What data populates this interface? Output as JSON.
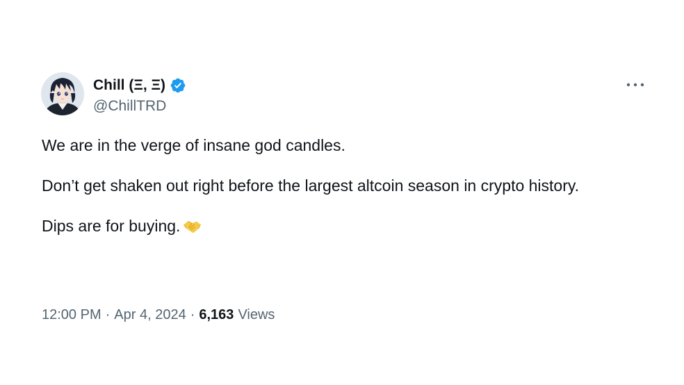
{
  "tweet": {
    "author": {
      "display_name": "Chill (Ξ, Ξ)",
      "handle": "@ChillTRD",
      "verified": true,
      "avatar_icon": "anime-character-avatar"
    },
    "more_icon": "more-options-icon",
    "paragraphs": [
      "We are in the verge of insane god candles.",
      "Don’t get shaken out right before the largest altcoin season in crypto history.",
      "Dips are for buying."
    ],
    "emoji_icon": "handshake-emoji",
    "meta": {
      "time": "12:00 PM",
      "separator": "·",
      "date": "Apr 4, 2024",
      "views_count": "6,163",
      "views_label": "Views"
    },
    "colors": {
      "text": "#0f1419",
      "secondary": "#536471",
      "verified_blue": "#1d9bf0"
    }
  }
}
